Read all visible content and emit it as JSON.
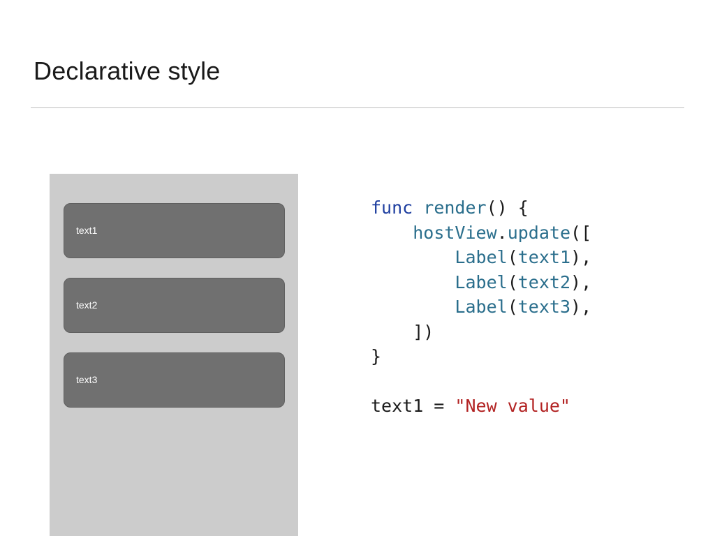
{
  "slide": {
    "title": "Declarative style"
  },
  "device": {
    "cards": [
      {
        "label": "text1"
      },
      {
        "label": "text2"
      },
      {
        "label": "text3"
      }
    ]
  },
  "code": {
    "lines": [
      [
        {
          "t": "func",
          "c": "kw"
        },
        {
          "t": " ",
          "c": "plain"
        },
        {
          "t": "render",
          "c": "fn"
        },
        {
          "t": "() {",
          "c": "plain"
        }
      ],
      [
        {
          "t": "    ",
          "c": "plain"
        },
        {
          "t": "hostView",
          "c": "fn"
        },
        {
          "t": ".",
          "c": "plain"
        },
        {
          "t": "update",
          "c": "fn"
        },
        {
          "t": "([",
          "c": "plain"
        }
      ],
      [
        {
          "t": "        ",
          "c": "plain"
        },
        {
          "t": "Label",
          "c": "fn"
        },
        {
          "t": "(",
          "c": "plain"
        },
        {
          "t": "text1",
          "c": "fn"
        },
        {
          "t": "),",
          "c": "plain"
        }
      ],
      [
        {
          "t": "        ",
          "c": "plain"
        },
        {
          "t": "Label",
          "c": "fn"
        },
        {
          "t": "(",
          "c": "plain"
        },
        {
          "t": "text2",
          "c": "fn"
        },
        {
          "t": "),",
          "c": "plain"
        }
      ],
      [
        {
          "t": "        ",
          "c": "plain"
        },
        {
          "t": "Label",
          "c": "fn"
        },
        {
          "t": "(",
          "c": "plain"
        },
        {
          "t": "text3",
          "c": "fn"
        },
        {
          "t": "),",
          "c": "plain"
        }
      ],
      [
        {
          "t": "    ])",
          "c": "plain"
        }
      ],
      [
        {
          "t": "}",
          "c": "plain"
        }
      ],
      [
        {
          "t": "",
          "c": "plain"
        }
      ],
      [
        {
          "t": "text1 = ",
          "c": "plain"
        },
        {
          "t": "\"New value\"",
          "c": "str"
        }
      ]
    ]
  },
  "colors": {
    "keyword": "#1f3fa0",
    "identifier": "#2a6e8c",
    "string": "#b22222",
    "panel": "#cccccc",
    "card": "#707070"
  }
}
